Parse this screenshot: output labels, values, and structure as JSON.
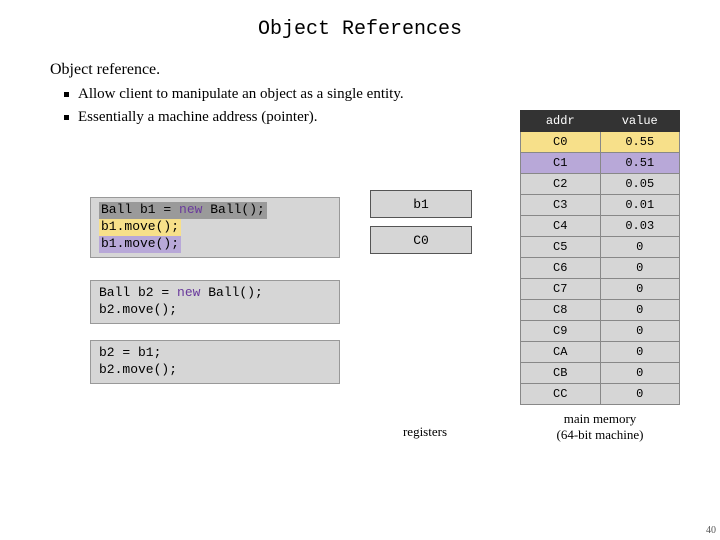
{
  "title": "Object References",
  "subhead": "Object reference.",
  "bullets": [
    "Allow client to manipulate an object as a single entity.",
    "Essentially a machine address (pointer)."
  ],
  "code1": {
    "l1a": "Ball b1 = ",
    "l1b": "new",
    "l1c": " Ball();",
    "l2": "b1.move();",
    "l3": "b1.move();"
  },
  "code2": {
    "l1a": "Ball b2 = ",
    "l1b": "new",
    "l1c": " Ball();",
    "l2": "b2.move();"
  },
  "code3": {
    "l1": "b2 = b1;",
    "l2": "b2.move();"
  },
  "registers": {
    "r1": "b1",
    "r2": "C0",
    "label": "registers"
  },
  "memory": {
    "header": {
      "addr": "addr",
      "value": "value"
    },
    "rows": [
      {
        "addr": "C0",
        "value": "0.55",
        "hl": "yellow"
      },
      {
        "addr": "C1",
        "value": "0.51",
        "hl": "purple"
      },
      {
        "addr": "C2",
        "value": "0.05",
        "hl": ""
      },
      {
        "addr": "C3",
        "value": "0.01",
        "hl": ""
      },
      {
        "addr": "C4",
        "value": "0.03",
        "hl": ""
      },
      {
        "addr": "C5",
        "value": "0",
        "hl": ""
      },
      {
        "addr": "C6",
        "value": "0",
        "hl": ""
      },
      {
        "addr": "C7",
        "value": "0",
        "hl": ""
      },
      {
        "addr": "C8",
        "value": "0",
        "hl": ""
      },
      {
        "addr": "C9",
        "value": "0",
        "hl": ""
      },
      {
        "addr": "CA",
        "value": "0",
        "hl": ""
      },
      {
        "addr": "CB",
        "value": "0",
        "hl": ""
      },
      {
        "addr": "CC",
        "value": "0",
        "hl": ""
      }
    ],
    "label1": "main memory",
    "label2": "(64-bit machine)"
  },
  "page_num": "40"
}
